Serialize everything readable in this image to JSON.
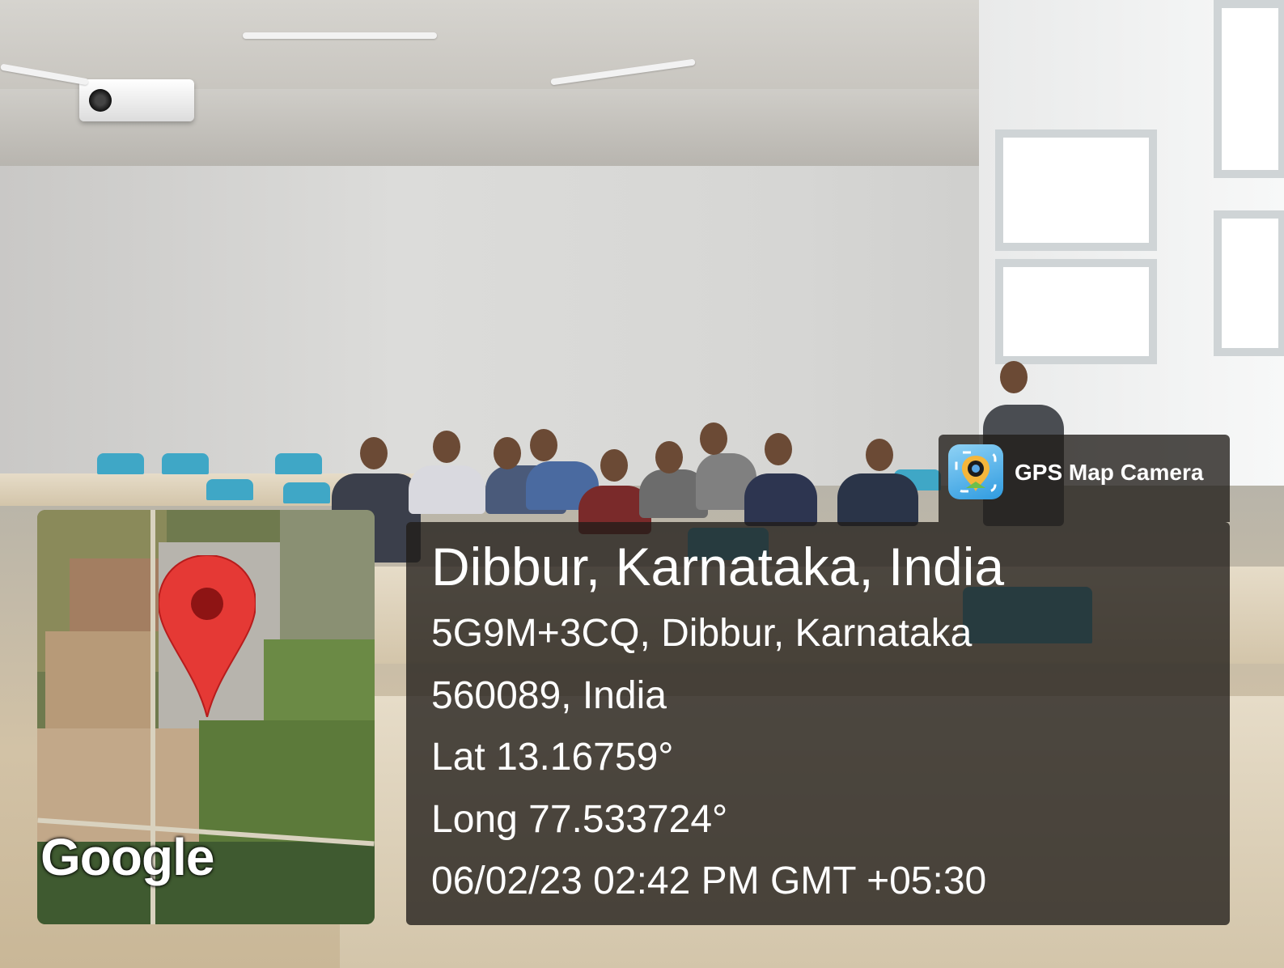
{
  "overlay": {
    "app_name": "GPS Map Camera",
    "app_icon": "gps-camera-app-icon",
    "map_provider": "Google",
    "location_title": "Dibbur, Karnataka, India",
    "address_line_1": "5G9M+3CQ, Dibbur, Karnataka",
    "address_line_2": "560089, India",
    "latitude": "Lat 13.16759°",
    "longitude": "Long 77.533724°",
    "datetime": "06/02/23 02:42 PM GMT +05:30"
  },
  "colors": {
    "panel_background": "#201c18",
    "pin": "#e53935",
    "chair": "#3fa7c6"
  }
}
